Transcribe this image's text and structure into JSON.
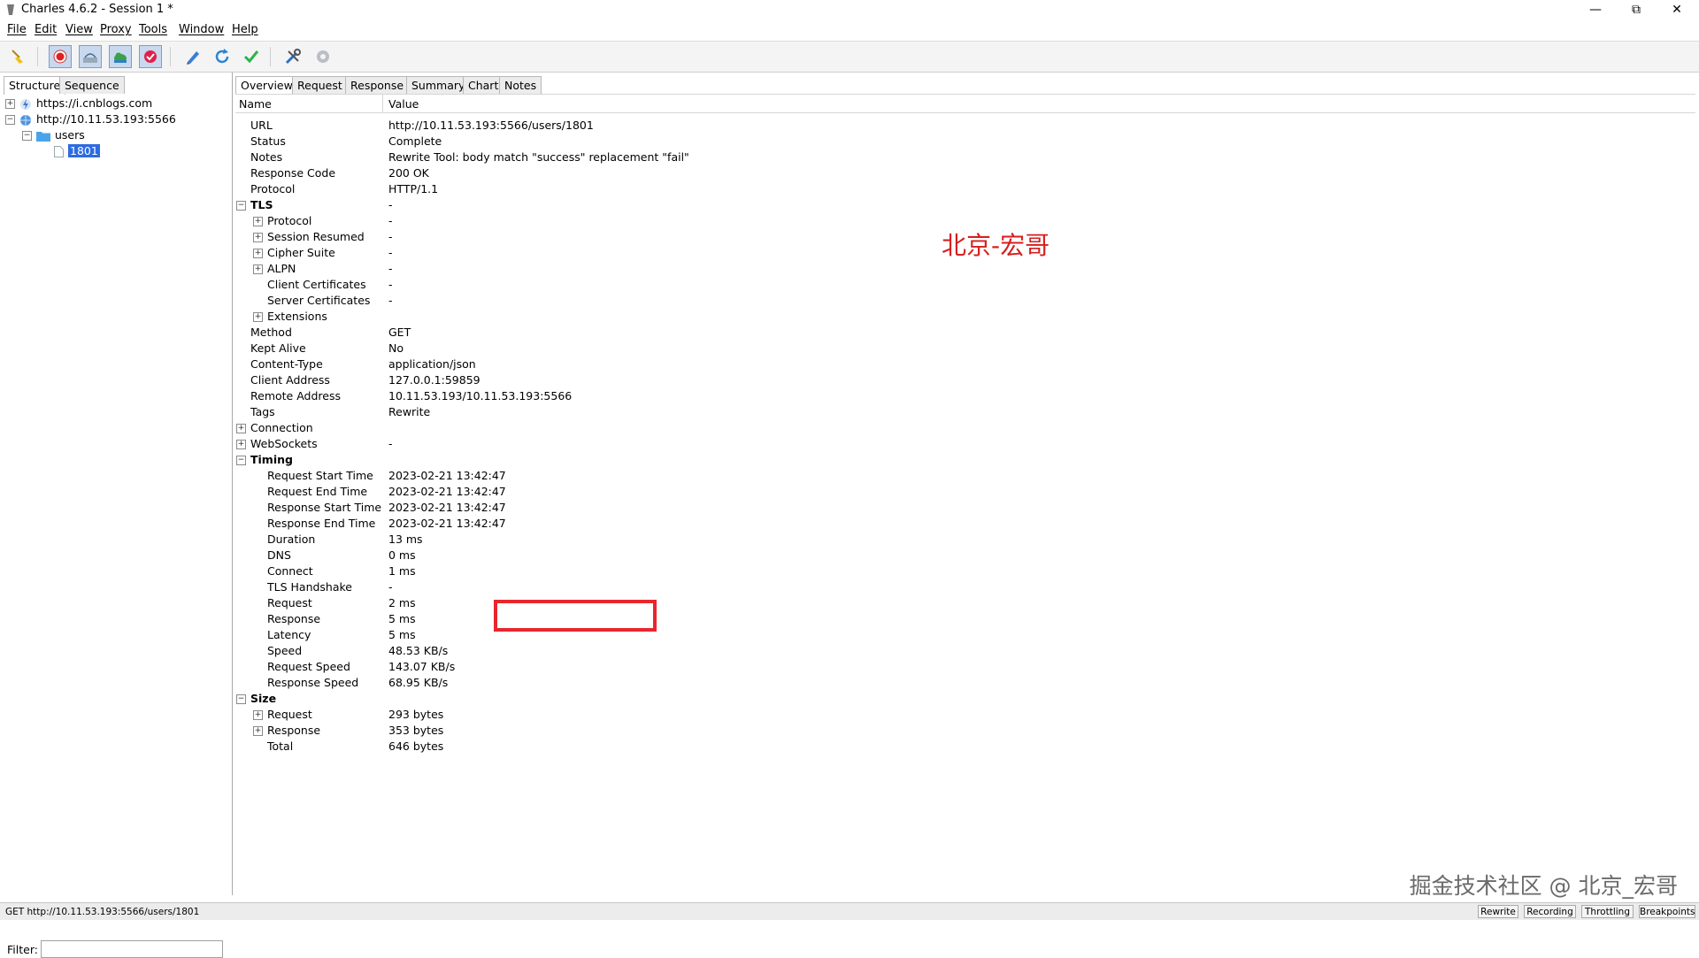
{
  "window": {
    "title": "Charles 4.6.2 - Session 1 *"
  },
  "menu": [
    "File",
    "Edit",
    "View",
    "Proxy",
    "Tools",
    "Window",
    "Help"
  ],
  "left": {
    "tabs": [
      "Structure",
      "Sequence"
    ],
    "tree": [
      {
        "label": "https://i.cnblogs.com",
        "expander": "+"
      },
      {
        "label": "http://10.11.53.193:5566",
        "expander": "−"
      },
      {
        "label": "users",
        "expander": "−"
      },
      {
        "label": "1801",
        "selected": true
      }
    ],
    "filter_label": "Filter:"
  },
  "right": {
    "tabs": [
      "Overview",
      "Request",
      "Response",
      "Summary",
      "Chart",
      "Notes"
    ],
    "columns": {
      "name": "Name",
      "value": "Value"
    },
    "rows": [
      {
        "name": "URL",
        "value": "http://10.11.53.193:5566/users/1801"
      },
      {
        "name": "Status",
        "value": "Complete"
      },
      {
        "name": "Notes",
        "value": "Rewrite Tool: body match \"success\" replacement \"fail\""
      },
      {
        "name": "Response Code",
        "value": "200 OK"
      },
      {
        "name": "Protocol",
        "value": "HTTP/1.1"
      },
      {
        "name": "TLS",
        "value": "-",
        "group": true,
        "expander": "−"
      },
      {
        "name": "Protocol",
        "value": "-",
        "indent": true,
        "expander": "+"
      },
      {
        "name": "Session Resumed",
        "value": "-",
        "indent": true,
        "expander": "+"
      },
      {
        "name": "Cipher Suite",
        "value": "-",
        "indent": true,
        "expander": "+"
      },
      {
        "name": "ALPN",
        "value": "-",
        "indent": true,
        "expander": "+"
      },
      {
        "name": "Client Certificates",
        "value": "-",
        "indent": true
      },
      {
        "name": "Server Certificates",
        "value": "-",
        "indent": true
      },
      {
        "name": "Extensions",
        "value": "",
        "indent": true,
        "expander": "+"
      },
      {
        "name": "Method",
        "value": "GET"
      },
      {
        "name": "Kept Alive",
        "value": "No"
      },
      {
        "name": "Content-Type",
        "value": "application/json"
      },
      {
        "name": "Client Address",
        "value": "127.0.0.1:59859"
      },
      {
        "name": "Remote Address",
        "value": "10.11.53.193/10.11.53.193:5566"
      },
      {
        "name": "Tags",
        "value": "Rewrite"
      },
      {
        "name": "Connection",
        "value": "",
        "expander": "+"
      },
      {
        "name": "WebSockets",
        "value": "-",
        "expander": "+"
      },
      {
        "name": "Timing",
        "value": "",
        "group": true,
        "expander": "−"
      },
      {
        "name": "Request Start Time",
        "value": "2023-02-21 13:42:47",
        "indent": true
      },
      {
        "name": "Request End Time",
        "value": "2023-02-21 13:42:47",
        "indent": true
      },
      {
        "name": "Response Start Time",
        "value": "2023-02-21 13:42:47",
        "indent": true
      },
      {
        "name": "Response End Time",
        "value": "2023-02-21 13:42:47",
        "indent": true
      },
      {
        "name": "Duration",
        "value": "13 ms",
        "indent": true
      },
      {
        "name": "DNS",
        "value": "0 ms",
        "indent": true
      },
      {
        "name": "Connect",
        "value": "1 ms",
        "indent": true
      },
      {
        "name": "TLS Handshake",
        "value": "-",
        "indent": true
      },
      {
        "name": "Request",
        "value": "2 ms",
        "indent": true
      },
      {
        "name": "Response",
        "value": "5 ms",
        "indent": true
      },
      {
        "name": "Latency",
        "value": "5 ms",
        "indent": true
      },
      {
        "name": "Speed",
        "value": "48.53 KB/s",
        "indent": true
      },
      {
        "name": "Request Speed",
        "value": "143.07 KB/s",
        "indent": true
      },
      {
        "name": "Response Speed",
        "value": "68.95 KB/s",
        "indent": true
      },
      {
        "name": "Size",
        "value": "",
        "group": true,
        "expander": "−"
      },
      {
        "name": "Request",
        "value": "293 bytes",
        "indent": true,
        "expander": "+"
      },
      {
        "name": "Response",
        "value": "353 bytes",
        "indent": true,
        "expander": "+"
      },
      {
        "name": "Total",
        "value": "646 bytes",
        "indent": true
      }
    ]
  },
  "annotation": "北京-宏哥",
  "watermark": "掘金技术社区 @ 北京_宏哥",
  "statusbar": {
    "url": "GET http://10.11.53.193:5566/users/1801",
    "buttons": [
      "Rewrite",
      "Recording",
      "Throttling",
      "Breakpoints"
    ]
  }
}
